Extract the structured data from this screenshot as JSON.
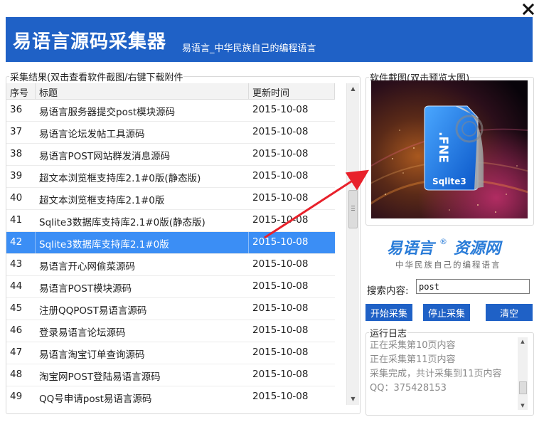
{
  "window": {
    "title": "易语言源码采集器",
    "subtitle": "易语言_中华民族自己的编程语言",
    "close_icon": "close-icon",
    "accent_color": "#1f61c6"
  },
  "results": {
    "group_label": "采集结果(双击查看软件截图/右键下载附件",
    "columns": [
      "序号",
      "标题",
      "更新时间"
    ],
    "rows": [
      {
        "no": "36",
        "title": "易语言服务器提交post模块源码",
        "date": "2015-10-08"
      },
      {
        "no": "37",
        "title": "易语言论坛发帖工具源码",
        "date": "2015-10-08"
      },
      {
        "no": "38",
        "title": "易语言POST网站群发消息源码",
        "date": "2015-10-08"
      },
      {
        "no": "39",
        "title": "超文本浏览框支持库2.1#0版(静态版)",
        "date": "2015-10-08"
      },
      {
        "no": "40",
        "title": "超文本浏览框支持库2.1#0版",
        "date": "2015-10-08"
      },
      {
        "no": "41",
        "title": "Sqlite3数据库支持库2.1#0版(静态版)",
        "date": "2015-10-08"
      },
      {
        "no": "42",
        "title": "Sqlite3数据库支持库2.1#0版",
        "date": "2015-10-08",
        "selected": true
      },
      {
        "no": "43",
        "title": "易语言开心网偷菜源码",
        "date": "2015-10-08"
      },
      {
        "no": "44",
        "title": "易语言POST模块源码",
        "date": "2015-10-08"
      },
      {
        "no": "45",
        "title": "注册QQPOST易语言源码",
        "date": "2015-10-08"
      },
      {
        "no": "46",
        "title": "登录易语言论坛源码",
        "date": "2015-10-08"
      },
      {
        "no": "47",
        "title": "易语言淘宝订单查询源码",
        "date": "2015-10-08"
      },
      {
        "no": "48",
        "title": "淘宝网POST登陆易语言源码",
        "date": "2015-10-08"
      },
      {
        "no": "49",
        "title": "QQ号申请post易语言源码",
        "date": "2015-10-08"
      }
    ],
    "selected_row_color": "#3b8ef5"
  },
  "screenshot": {
    "group_label": "软件截图(双击预览大图)",
    "file_ext_label": ".FNE",
    "product_label": "Sqlite3"
  },
  "logo": {
    "brand_text": "易语言",
    "brand_suffix": "资源网",
    "registered_mark": "®",
    "tagline": "中华民族自己的编程语言"
  },
  "search": {
    "label": "搜索内容:",
    "value": "post"
  },
  "buttons": {
    "start": "开始采集",
    "stop": "停止采集",
    "clear": "清空"
  },
  "log": {
    "group_label": "运行日志",
    "lines": [
      "正在采集第10页内容",
      "正在采集第11页内容",
      "采集完成，共计采集到11页内容",
      "QQ：375428153"
    ]
  }
}
